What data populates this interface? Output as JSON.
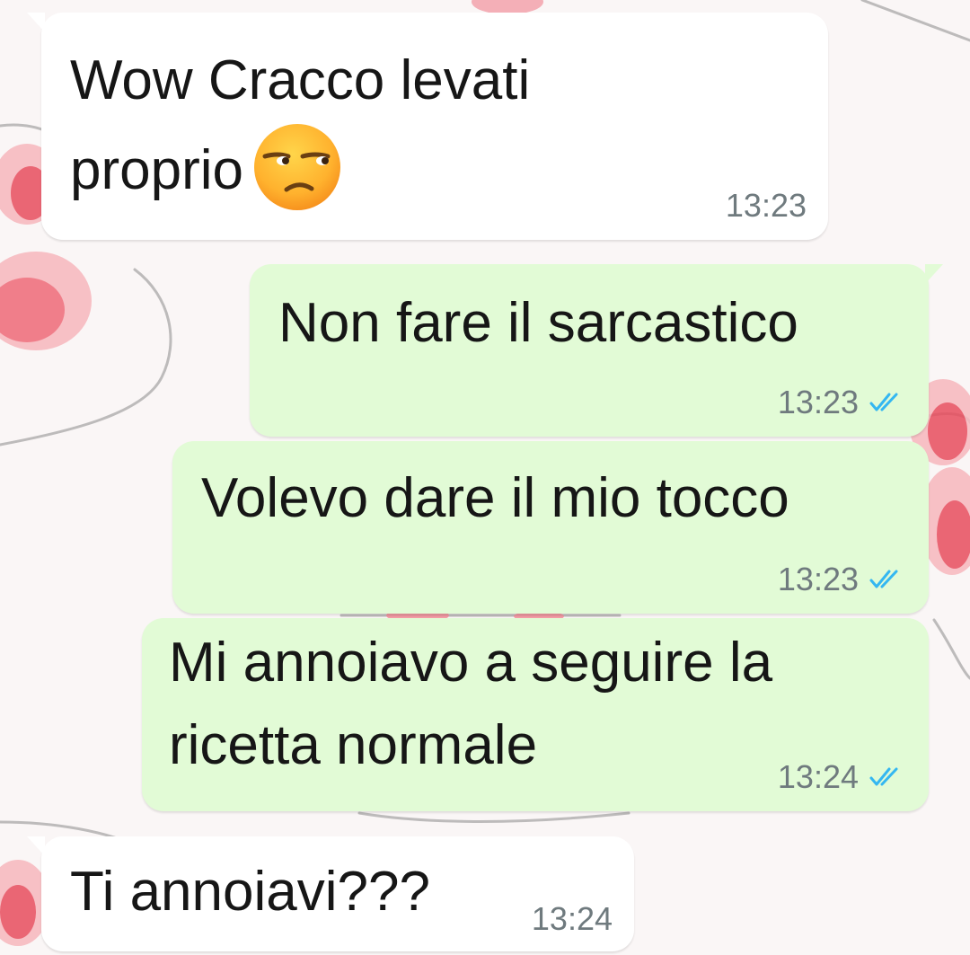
{
  "chat": {
    "messages": [
      {
        "direction": "incoming",
        "text": "Wow Cracco levati\nproprio",
        "emoji": "unamused-face-icon",
        "time": "13:23"
      },
      {
        "direction": "outgoing",
        "text": "Non fare il sarcastico",
        "time": "13:23",
        "status": "read"
      },
      {
        "direction": "outgoing",
        "text": "Volevo dare il mio tocco",
        "time": "13:23",
        "status": "read"
      },
      {
        "direction": "outgoing",
        "text": "Mi annoiavo a seguire la\nricetta normale",
        "time": "13:24",
        "status": "read"
      },
      {
        "direction": "incoming",
        "text": "Ti annoiavi???",
        "time": "13:24"
      }
    ]
  },
  "colors": {
    "incoming_bubble": "#ffffff",
    "outgoing_bubble": "#e2fbd6",
    "read_check": "#34b7f1",
    "timestamp": "#6f7a7e",
    "wallpaper_accent": "#e84d5e"
  }
}
